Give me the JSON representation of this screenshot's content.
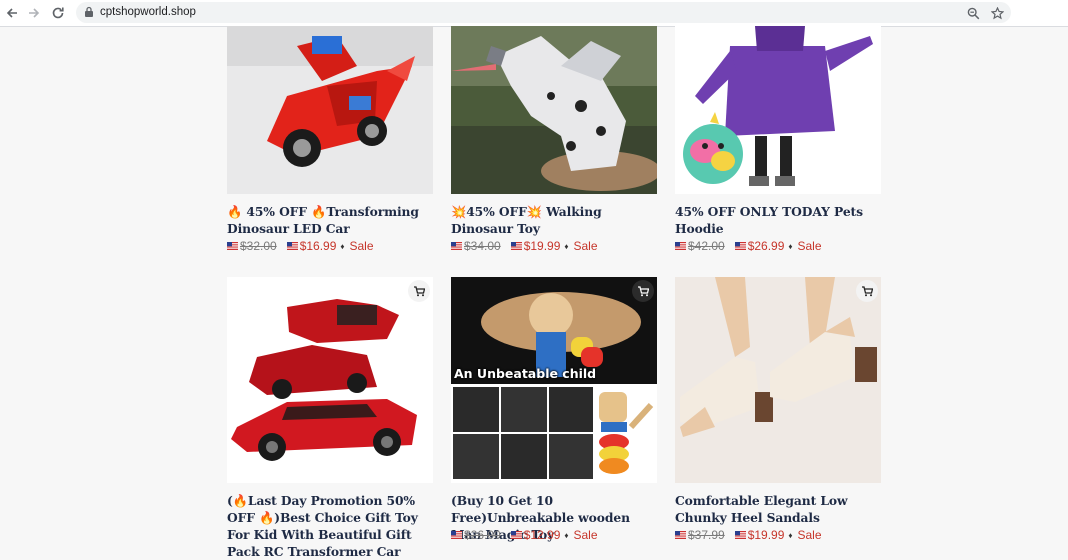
{
  "browser": {
    "url": "cptshopworld.shop"
  },
  "currency_flag": "us-flag-icon",
  "products": [
    {
      "title": "🔥 45% OFF 🔥Transforming Dinosaur LED Car",
      "old_price": "$32.00",
      "new_price": "$16.99",
      "sale": "Sale",
      "image": "red transforming dinosaur car toy"
    },
    {
      "title": "💥45% OFF💥 Walking Dinosaur Toy",
      "old_price": "$34.00",
      "new_price": "$19.99",
      "sale": "Sale",
      "image": "white spotted robot dinosaur toy"
    },
    {
      "title": "45% OFF ONLY TODAY Pets Hoodie",
      "old_price": "$42.00",
      "new_price": "$26.99",
      "sale": "Sale",
      "image": "child in purple plush hoodie with unicorn pillow"
    },
    {
      "title": "(🔥Last Day Promotion 50% OFF 🔥)Best Choice Gift Toy For Kid With Beautiful Gift Pack RC Transformer Car",
      "old_price": "",
      "new_price": "",
      "sale": "",
      "image": "red sports car robot transformer"
    },
    {
      "title": "(Buy 10 Get 10 Free)Unbreakable wooden Man Magic Toy",
      "old_price": "$26.00",
      "new_price": "$12.99",
      "sale": "Sale",
      "image": "wooden tumbler man toy",
      "overlay_text": "An Unbeatable child"
    },
    {
      "title": "Comfortable Elegant Low Chunky Heel Sandals",
      "old_price": "$37.99",
      "new_price": "$19.99",
      "sale": "Sale",
      "image": "beige low chunky heel sandals"
    }
  ],
  "colors": {
    "title": "#1e2a44",
    "sale_price": "#c6362b",
    "old_price": "#7a7a7a"
  }
}
